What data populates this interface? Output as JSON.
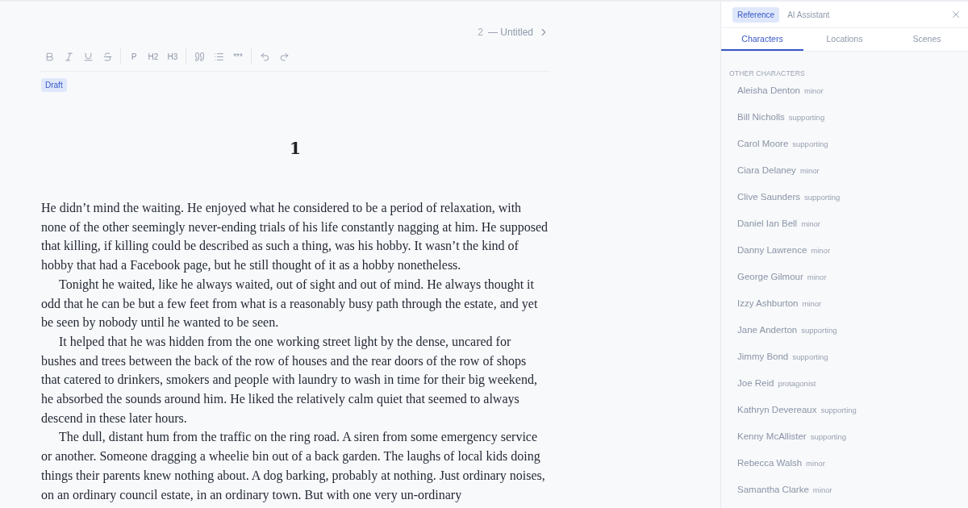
{
  "header": {
    "number": "2",
    "title": "— Untitled"
  },
  "toolbar": {
    "block_buttons": [
      "P",
      "H2",
      "H3"
    ],
    "divider_button": "***"
  },
  "status_badge": "Draft",
  "chapter_heading": "1",
  "paragraphs": [
    "He didn’t mind the waiting. He enjoyed what he considered to be a period of relaxation, with none of the other seemingly never-ending trials of his life constantly nagging at him. He supposed that killing, if killing could be described as such a thing, was his hobby. It wasn’t the kind of hobby that had a Facebook page, but he still thought of it as a hobby nonetheless.",
    "Tonight he waited, like he always waited, out of sight and out of mind. He always thought it odd that he can be but a few feet from what is a reasonably busy path through the estate, and yet be seen by nobody until he wanted to be seen.",
    "It helped that he was hidden from the one working street light by the dense, uncared for bushes and trees between the back of the row of houses and the rear doors of the row of shops that catered to drinkers, smokers and people with laundry to wash in time for their big weekend, he absorbed the sounds around him. He liked the relatively calm quiet that seemed to always descend in these later hours.",
    "The dull, distant hum from the traffic on the ring road. A siren from some emergency service or another. Someone dragging a wheelie bin out of a back garden. The laughs of local kids doing things their parents knew nothing about. A dog barking, probably at nothing. Just ordinary noises, on an ordinary council estate, in an ordinary town. But with one very un-ordinary"
  ],
  "panel_tabs": [
    {
      "label": "Reference",
      "selected": true
    },
    {
      "label": "AI Assistant",
      "selected": false
    }
  ],
  "sub_tabs": [
    {
      "label": "Characters",
      "selected": true
    },
    {
      "label": "Locations",
      "selected": false
    },
    {
      "label": "Scenes",
      "selected": false
    }
  ],
  "section_title": "OTHER CHARACTERS",
  "characters": [
    {
      "name": "Aleisha Denton",
      "role": "minor"
    },
    {
      "name": "Bill Nicholls",
      "role": "supporting"
    },
    {
      "name": "Carol Moore",
      "role": "supporting"
    },
    {
      "name": "Ciara Delaney",
      "role": "minor"
    },
    {
      "name": "Clive Saunders",
      "role": "supporting"
    },
    {
      "name": "Daniel Ian Bell",
      "role": "minor"
    },
    {
      "name": "Danny Lawrence",
      "role": "minor"
    },
    {
      "name": "George Gilmour",
      "role": "minor"
    },
    {
      "name": "Izzy Ashburton",
      "role": "minor"
    },
    {
      "name": "Jane Anderton",
      "role": "supporting"
    },
    {
      "name": "Jimmy Bond",
      "role": "supporting"
    },
    {
      "name": "Joe Reid",
      "role": "protagonist"
    },
    {
      "name": "Kathryn Devereaux",
      "role": "supporting"
    },
    {
      "name": "Kenny McAllister",
      "role": "supporting"
    },
    {
      "name": "Rebecca Walsh",
      "role": "minor"
    },
    {
      "name": "Samantha Clarke",
      "role": "minor"
    }
  ]
}
